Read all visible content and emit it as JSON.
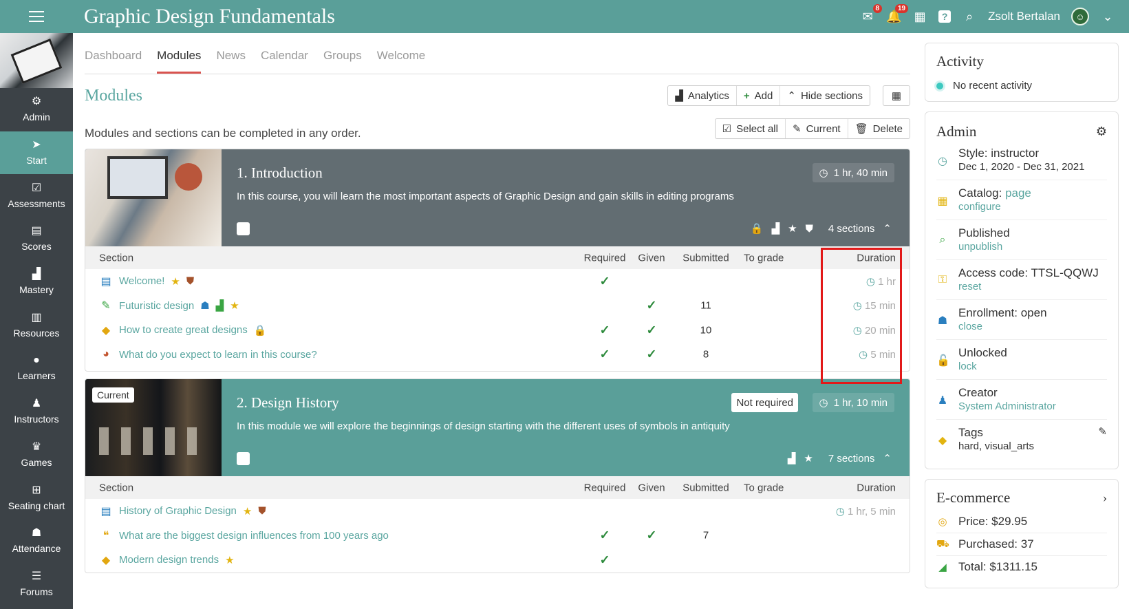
{
  "app": {
    "title": "Graphic Design Fundamentals"
  },
  "topbar": {
    "mail_badge": "8",
    "notif_badge": "19",
    "user_name": "Zsolt Bertalan"
  },
  "sidebar": {
    "items": [
      {
        "label": "Admin",
        "icon": "gear-icon"
      },
      {
        "label": "Start",
        "icon": "send-icon"
      },
      {
        "label": "Assessments",
        "icon": "checkbox-icon"
      },
      {
        "label": "Scores",
        "icon": "grid-table-icon"
      },
      {
        "label": "Mastery",
        "icon": "bar-chart-icon"
      },
      {
        "label": "Resources",
        "icon": "books-icon"
      },
      {
        "label": "Learners",
        "icon": "person-icon"
      },
      {
        "label": "Instructors",
        "icon": "person-tie-icon"
      },
      {
        "label": "Games",
        "icon": "trophy-icon"
      },
      {
        "label": "Seating chart",
        "icon": "seats-icon"
      },
      {
        "label": "Attendance",
        "icon": "people-icon"
      },
      {
        "label": "Forums",
        "icon": "list-icon"
      }
    ]
  },
  "tabs": [
    "Dashboard",
    "Modules",
    "News",
    "Calendar",
    "Groups",
    "Welcome"
  ],
  "modules_page": {
    "title": "Modules",
    "subtitle": "Modules and sections can be completed in any order.",
    "toolbar": {
      "analytics": "Analytics",
      "add": "Add",
      "hide_sections": "Hide sections"
    },
    "toolbar2": {
      "select_all": "Select all",
      "current": "Current",
      "delete": "Delete"
    }
  },
  "table_headers": {
    "section": "Section",
    "required": "Required",
    "given": "Given",
    "submitted": "Submitted",
    "to_grade": "To grade",
    "duration": "Duration"
  },
  "modules": [
    {
      "title": "1. Introduction",
      "description": "In this course, you will learn the most important aspects of Graphic Design and gain skills in editing programs",
      "duration": "1 hr, 40 min",
      "sections_count": "4 sections",
      "sections": [
        {
          "name": "Welcome!",
          "required": true,
          "given": false,
          "submitted": "",
          "duration": "1 hr"
        },
        {
          "name": "Futuristic design",
          "required": false,
          "given": true,
          "submitted": "11",
          "duration": "15 min"
        },
        {
          "name": "How to create great designs",
          "required": true,
          "given": true,
          "submitted": "10",
          "duration": "20 min"
        },
        {
          "name": "What do you expect to learn in this course?",
          "required": true,
          "given": true,
          "submitted": "8",
          "duration": "5 min"
        }
      ]
    },
    {
      "title": "2. Design History",
      "tag": "Current",
      "not_required": "Not required",
      "description": "In this module we will explore the beginnings of design starting with the different uses of symbols in antiquity",
      "duration": "1 hr, 10 min",
      "sections_count": "7 sections",
      "sections": [
        {
          "name": "History of Graphic Design",
          "required": false,
          "given": false,
          "submitted": "",
          "duration": "1 hr, 5 min"
        },
        {
          "name": "What are the biggest design influences from 100 years ago",
          "required": true,
          "given": true,
          "submitted": "7",
          "duration": ""
        },
        {
          "name": "Modern design trends",
          "required": true,
          "given": false,
          "submitted": "",
          "duration": ""
        }
      ]
    }
  ],
  "activity": {
    "title": "Activity",
    "empty": "No recent activity"
  },
  "admin": {
    "title": "Admin",
    "style": "Style: instructor",
    "dates": "Dec 1, 2020 - Dec 31, 2021",
    "catalog": "Catalog:",
    "catalog_link": "page",
    "catalog_action": "configure",
    "published": "Published",
    "published_action": "unpublish",
    "access_code": "Access code: TTSL-QQWJ",
    "access_action": "reset",
    "enrollment": "Enrollment: open",
    "enrollment_action": "close",
    "unlocked": "Unlocked",
    "unlocked_action": "lock",
    "creator": "Creator",
    "creator_name": "System Administrator",
    "tags": "Tags",
    "tags_value": "hard, visual_arts"
  },
  "ecommerce": {
    "title": "E-commerce",
    "price": "Price: $29.95",
    "purchased": "Purchased: 37",
    "total": "Total: $1311.15"
  },
  "colors": {
    "brand": "#5a9f99",
    "sidebar": "#3c4247",
    "accent_link": "#5aa6a0",
    "highlight": "#e21919"
  }
}
